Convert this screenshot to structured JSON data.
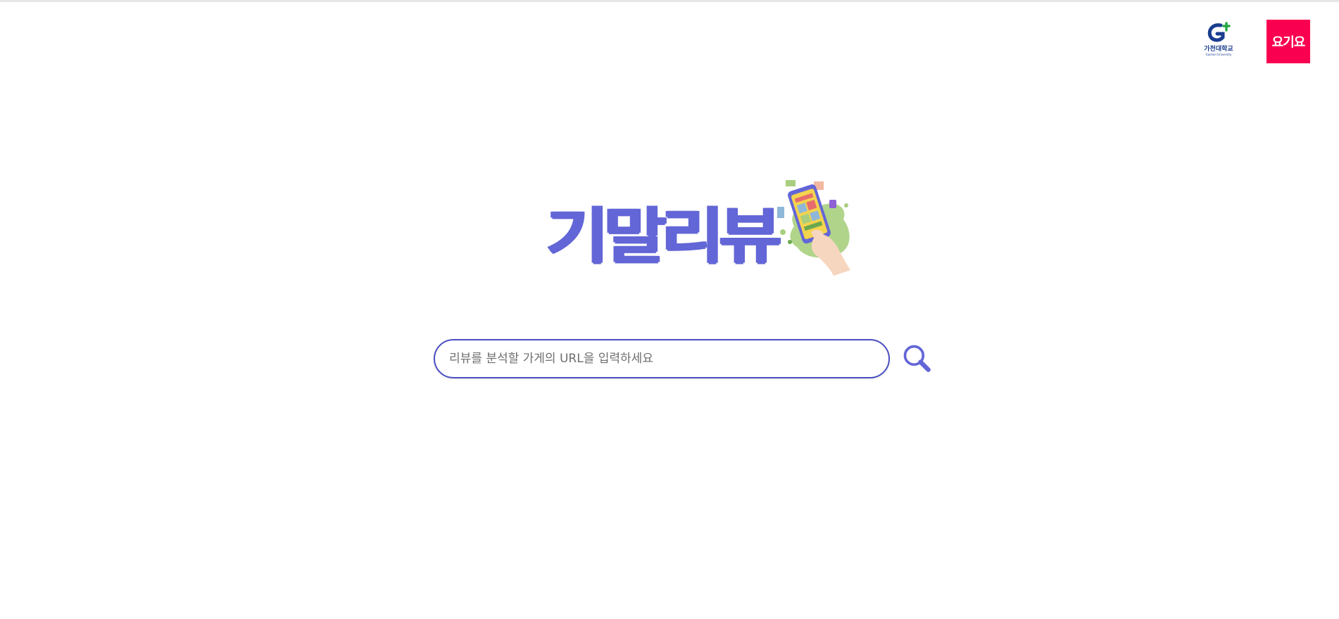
{
  "partners": {
    "gachon": {
      "name_ko": "가천대학교",
      "name_en": "Gachon University",
      "color": "#1a3d8f"
    },
    "yogiyo": {
      "label": "요기요",
      "color": "#fa0050"
    }
  },
  "brand": {
    "title": "기말리뷰",
    "color": "#6366d6"
  },
  "illustration": {
    "icon": "phone-in-hand-illustration"
  },
  "search": {
    "placeholder": "리뷰를 분석할 가게의 URL을 입력하세요",
    "value": "",
    "icon": "search-icon",
    "accent": "#4b4fc2"
  }
}
